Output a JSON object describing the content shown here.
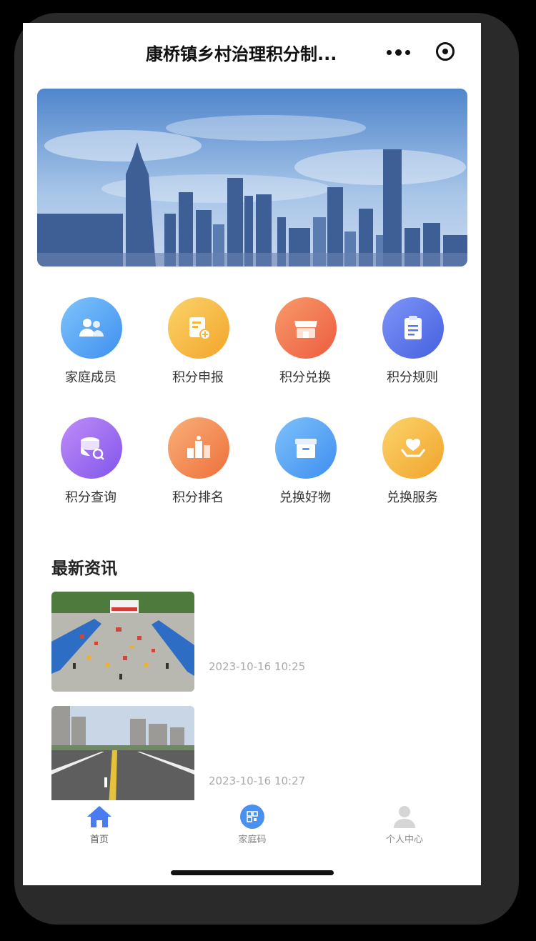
{
  "header": {
    "title": "康桥镇乡村治理积分制..."
  },
  "grid": [
    {
      "label": "家庭成员",
      "icon": "family-members-icon",
      "color": "#5aa7f5"
    },
    {
      "label": "积分申报",
      "icon": "points-declare-icon",
      "color": "#f6b93a"
    },
    {
      "label": "积分兑换",
      "icon": "points-exchange-store-icon",
      "color": "#f0704e"
    },
    {
      "label": "积分规则",
      "icon": "points-rules-icon",
      "color": "#5b74ea"
    },
    {
      "label": "积分查询",
      "icon": "points-query-icon",
      "color": "#9a6cf0"
    },
    {
      "label": "积分排名",
      "icon": "points-ranking-icon",
      "color": "#f28a4a"
    },
    {
      "label": "兑换好物",
      "icon": "exchange-goods-icon",
      "color": "#4fa0f2"
    },
    {
      "label": "兑换服务",
      "icon": "exchange-service-icon",
      "color": "#f5b53b"
    }
  ],
  "news": {
    "title": "最新资讯",
    "items": [
      {
        "time": "2023-10-16 10:25"
      },
      {
        "time": "2023-10-16 10:27"
      }
    ]
  },
  "tabbar": [
    {
      "label": "首页",
      "icon": "home-icon",
      "active": true
    },
    {
      "label": "家庭码",
      "icon": "family-qrcode-icon",
      "active": false
    },
    {
      "label": "个人中心",
      "icon": "user-center-icon",
      "active": false
    }
  ]
}
